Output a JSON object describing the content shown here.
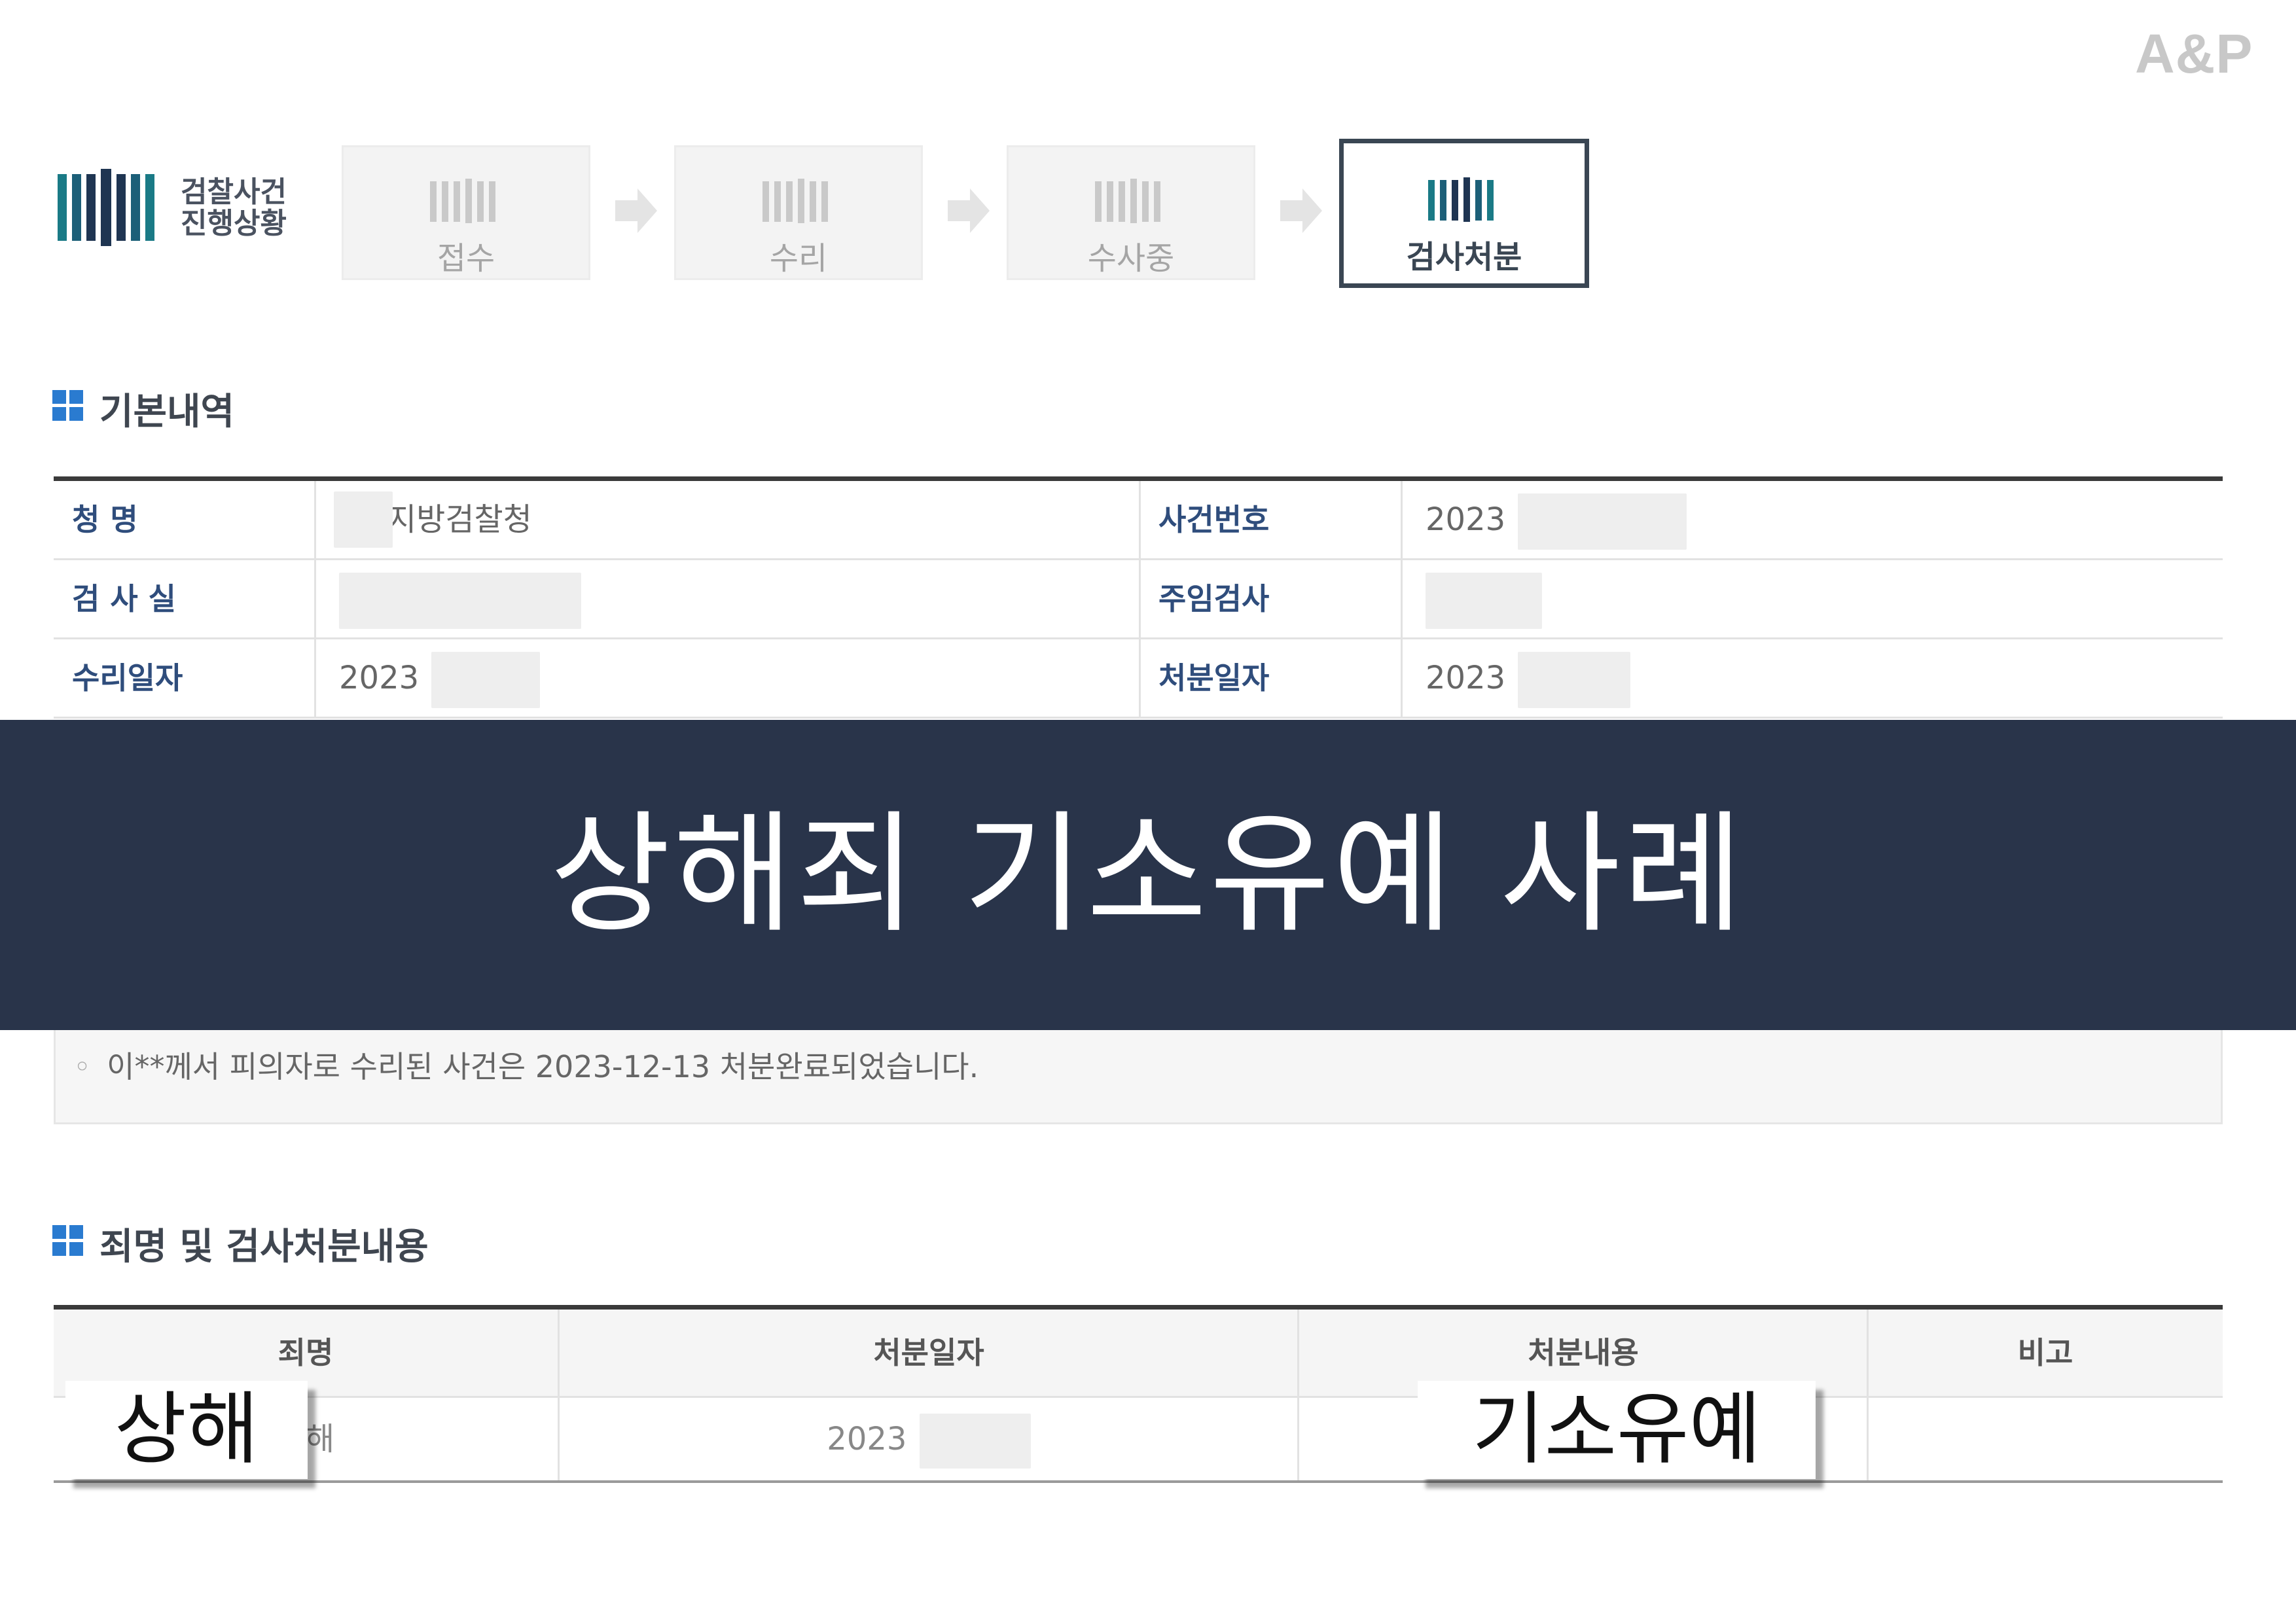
{
  "brand": "A&P",
  "header": {
    "logo_line1": "검찰사건",
    "logo_line2": "진행상황"
  },
  "steps": [
    {
      "label": "접수",
      "active": false
    },
    {
      "label": "수리",
      "active": false
    },
    {
      "label": "수사중",
      "active": false
    },
    {
      "label": "검사처분",
      "active": true
    }
  ],
  "basic_info": {
    "title": "기본내역",
    "rows": [
      {
        "label1": "청    명",
        "value1": "지방검찰청",
        "label2": "사건번호",
        "value2": "2023"
      },
      {
        "label1": "검 사 실",
        "value1": "",
        "label2": "주임검사",
        "value2": ""
      },
      {
        "label1": "수리일자",
        "value1": "2023",
        "label2": "처분일자",
        "value2": "2023"
      }
    ]
  },
  "banner": {
    "text": "상해죄 기소유예 사례"
  },
  "notice": {
    "bullet": "◦",
    "text": "이**께서 피의자로 수리된 사건은 2023-12-13 처분완료되었습니다."
  },
  "disposition": {
    "title": "죄명 및 검사처분내용",
    "headers": [
      "죄명",
      "처분일자",
      "처분내용",
      "비고"
    ],
    "row": {
      "charge": "상해",
      "date": "2023",
      "result": "기소유예",
      "note": ""
    }
  },
  "callouts": {
    "charge": "상해",
    "result": "기소유예"
  },
  "colors": {
    "banner_bg": "#29344a",
    "header_label": "#2f4d7c",
    "logo_teal": "#1a6f7c",
    "logo_navy": "#1f3552"
  }
}
